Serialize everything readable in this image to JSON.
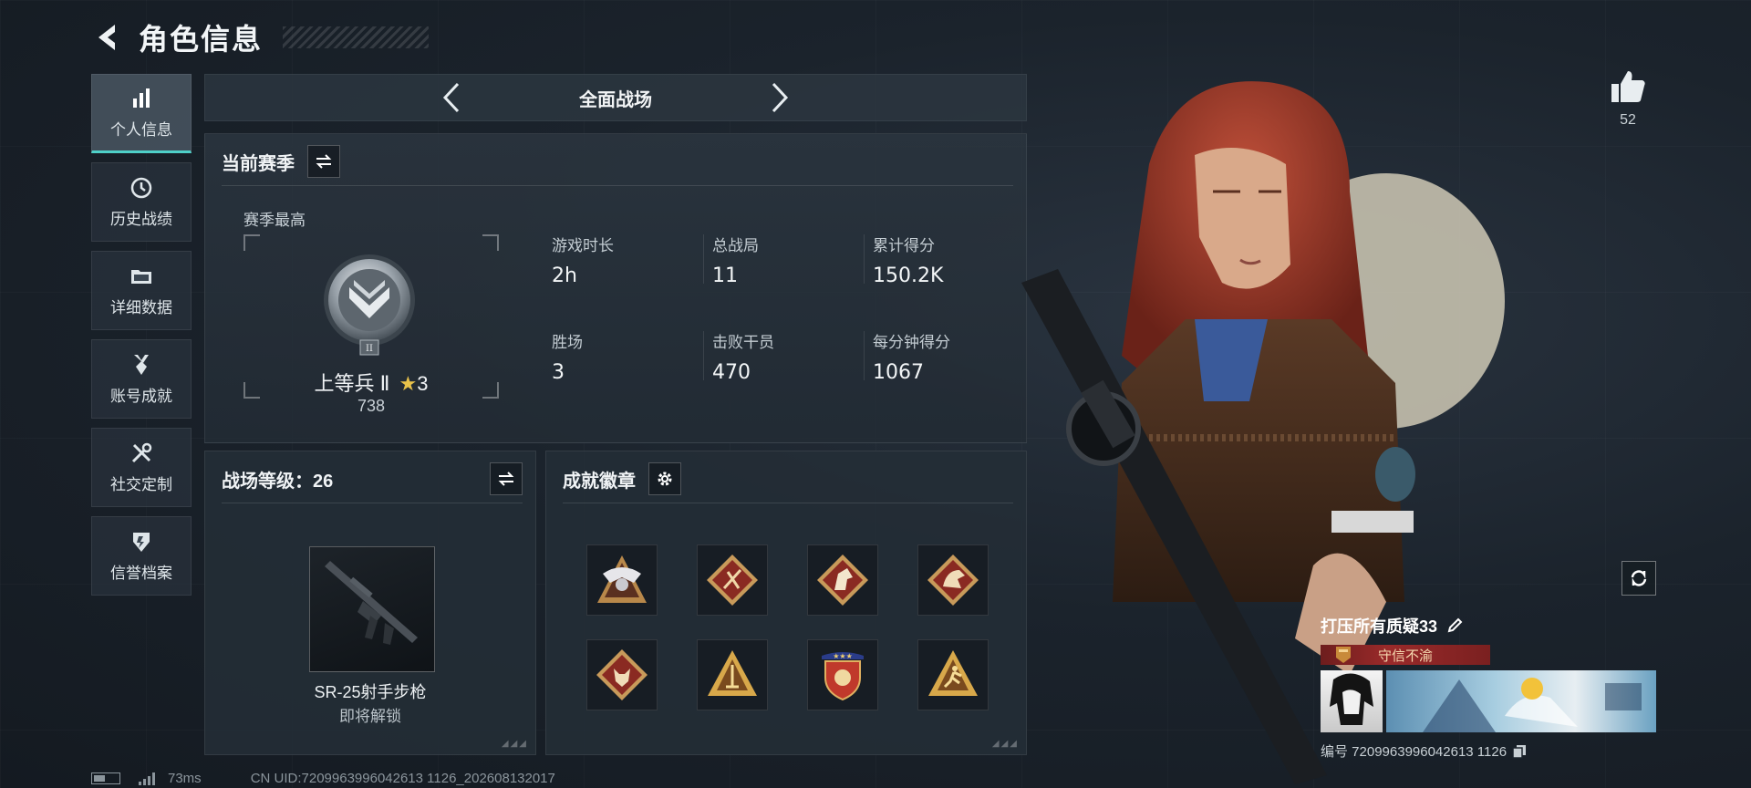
{
  "header": {
    "title": "角色信息"
  },
  "sidebar": {
    "items": [
      {
        "label": "个人信息",
        "active": true
      },
      {
        "label": "历史战绩"
      },
      {
        "label": "详细数据"
      },
      {
        "label": "账号成就"
      },
      {
        "label": "社交定制"
      },
      {
        "label": "信誉档案"
      }
    ]
  },
  "mode": {
    "name": "全面战场"
  },
  "season": {
    "title": "当前赛季",
    "best_label": "赛季最高",
    "rank_name": "上等兵 Ⅱ",
    "rank_stars": "3",
    "rank_points": "738",
    "stats": [
      {
        "label": "游戏时长",
        "value": "2h"
      },
      {
        "label": "总战局",
        "value": "11"
      },
      {
        "label": "累计得分",
        "value": "150.2K"
      },
      {
        "label": "胜场",
        "value": "3"
      },
      {
        "label": "击败干员",
        "value": "470"
      },
      {
        "label": "每分钟得分",
        "value": "1067"
      }
    ]
  },
  "level": {
    "title": "战场等级：26",
    "weapon_name": "SR-25射手步枪",
    "weapon_status": "即将解锁"
  },
  "achievements": {
    "title": "成就徽章",
    "badge_count": 8
  },
  "profile": {
    "likes": "52",
    "player_name": "打压所有质疑33",
    "title_banner": "守信不渝",
    "player_id": "编号 7209963996042613 1126"
  },
  "footer": {
    "ping": "73ms",
    "uid": "CN UID:7209963996042613 1126_202608132017"
  },
  "colors": {
    "accent": "#4ed0c8",
    "banner_red": "#9a2a2a",
    "star": "#e8c24a"
  }
}
